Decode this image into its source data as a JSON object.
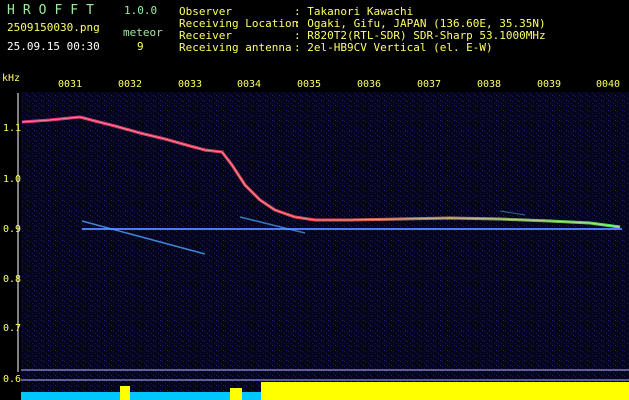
{
  "app": {
    "name": "HROFFT",
    "version": "1.0.0"
  },
  "file": {
    "name": "2509150030.png",
    "timestamp": "25.09.15 00:30"
  },
  "meteor": {
    "label": "meteor",
    "count": "9"
  },
  "info": {
    "observer_label": "Observer",
    "observer_value": ": Takanori Kawachi",
    "location_label": "Receiving Location",
    "location_value": ": Ogaki, Gifu, JAPAN (136.60E, 35.35N)",
    "receiver_label": "Receiver",
    "receiver_value": ": R820T2(RTL-SDR) SDR-Sharp 53.1000MHz",
    "antenna_label": "Receiving antenna",
    "antenna_value": ": 2el-HB9CV Vertical (el. E-W)"
  },
  "spectrogram": {
    "unit_label": "kHz",
    "time_ticks": [
      "0031",
      "0032",
      "0033",
      "0034",
      "0035",
      "0036",
      "0037",
      "0038",
      "0039",
      "0040"
    ],
    "freq_ticks": [
      "1.1",
      "1.0",
      "0.9",
      "0.8",
      "0.7",
      "0.6"
    ],
    "colors": {
      "header_text": "#9fe8a0",
      "signal_hot": "#ff4040",
      "signal_line": "#3a6bff",
      "level_bar": "#ffff00",
      "level_low": "#00c8ff"
    }
  }
}
